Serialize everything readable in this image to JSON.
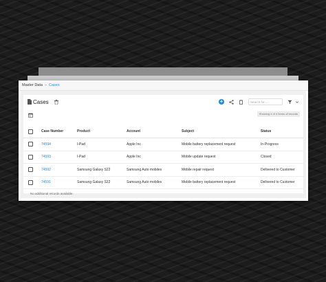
{
  "breadcrumb": {
    "parent": "Master Data",
    "current": "Cases"
  },
  "header": {
    "title": "Cases"
  },
  "toolbar": {
    "search_placeholder": "Search for..."
  },
  "records_count": "Showing 4 of 4 Items of records",
  "table": {
    "columns": [
      "Case Number",
      "Product",
      "Account",
      "Subject",
      "Status"
    ],
    "rows": [
      {
        "case_number": "74594",
        "product": "I-Pad",
        "account": "Apple Inc",
        "subject": "Mobile battery replacement request",
        "status": "In-Progress"
      },
      {
        "case_number": "74593",
        "product": "I-Pad",
        "account": "Apple Inc",
        "subject": "Mobile update request",
        "status": "Closed"
      },
      {
        "case_number": "74592",
        "product": "Samsung Galaxy S22",
        "account": "Samsung Auto mobiles",
        "subject": "Mobile repair request",
        "status": "Delivered to Customer"
      },
      {
        "case_number": "74591",
        "product": "Samsung Galaxy S22",
        "account": "Samsung Auto mobiles",
        "subject": "Mobile battery replacement request",
        "status": "Delivered to Customer"
      }
    ],
    "empty_message": "No additional records available."
  },
  "icons": [
    "document-icon",
    "trash-icon",
    "add-icon",
    "share-icon",
    "copy-icon",
    "filter-icon",
    "chevron-down-icon",
    "calendar-icon"
  ],
  "colors": {
    "accent": "#1e88e5",
    "link": "#2e86de"
  }
}
